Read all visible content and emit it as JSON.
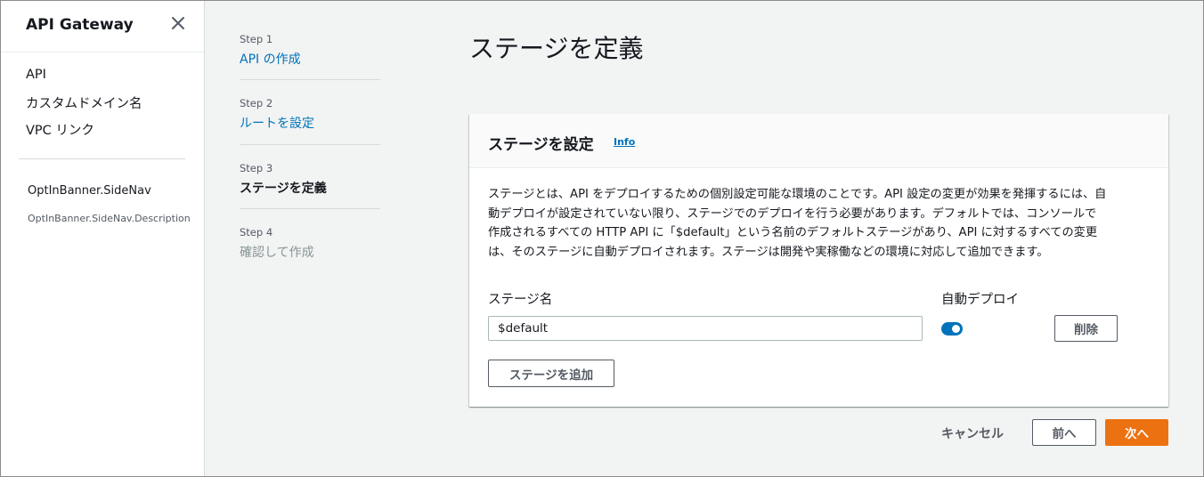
{
  "sidebar": {
    "title": "API Gateway",
    "links": [
      "API",
      "カスタムドメイン名",
      "VPC リンク"
    ],
    "optin_title": "OptInBanner.SideNav",
    "optin_description": "OptInBanner.SideNav.Description"
  },
  "steps": [
    {
      "num": "Step 1",
      "label": "API の作成",
      "state": "link"
    },
    {
      "num": "Step 2",
      "label": "ルートを設定",
      "state": "link"
    },
    {
      "num": "Step 3",
      "label": "ステージを定義",
      "state": "current"
    },
    {
      "num": "Step 4",
      "label": "確認して作成",
      "state": "disabled"
    }
  ],
  "page": {
    "title": "ステージを定義"
  },
  "panel": {
    "title": "ステージを設定",
    "info_link": "Info",
    "description_lines": [
      "ステージとは、API をデプロイするための個別設定可能な環境のことです。API 設定の変更が効果を発揮するには、自",
      "動デプロイが設定されていない限り、ステージでのデプロイを行う必要があります。デフォルトでは、コンソールで",
      "作成されるすべての HTTP API に「$default」という名前のデフォルトステージがあり、API に対するすべての変更",
      "は、そのステージに自動デプロイされます。ステージは開発や実稼働などの環境に対応して追加できます。"
    ],
    "stage_name_label": "ステージ名",
    "stage_name_value": "$default",
    "auto_deploy_label": "自動デプロイ",
    "auto_deploy_enabled": true,
    "delete_label": "削除",
    "add_stage_label": "ステージを追加"
  },
  "footer": {
    "cancel": "キャンセル",
    "prev": "前へ",
    "next": "次へ"
  },
  "colors": {
    "accent": "#0073bb",
    "primary_button": "#ec7211",
    "background": "#f2f3f3"
  }
}
